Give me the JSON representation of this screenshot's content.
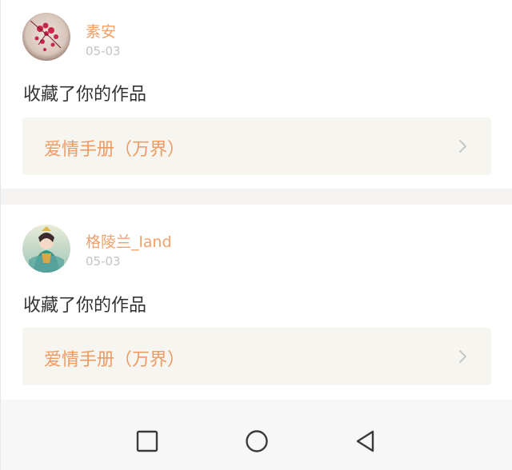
{
  "notifications": [
    {
      "username": "素安",
      "date": "05-03",
      "action": "收藏了你的作品",
      "work_title": "爱情手册（万界）",
      "avatar_icon": "flower-avatar-icon"
    },
    {
      "username": "格陵兰_land",
      "date": "05-03",
      "action": "收藏了你的作品",
      "work_title": "爱情手册（万界）",
      "avatar_icon": "illustrated-character-avatar-icon"
    }
  ],
  "nav": {
    "recent_icon": "square-recent-apps-icon",
    "home_icon": "circle-home-icon",
    "back_icon": "triangle-back-icon"
  },
  "colors": {
    "username": "#f0a06a",
    "work_title": "#ee9b63",
    "link_background": "#f6f5f0",
    "date": "#c3c3c3",
    "separator": "#f4f3f1",
    "navbar": "#f7f7f7"
  }
}
